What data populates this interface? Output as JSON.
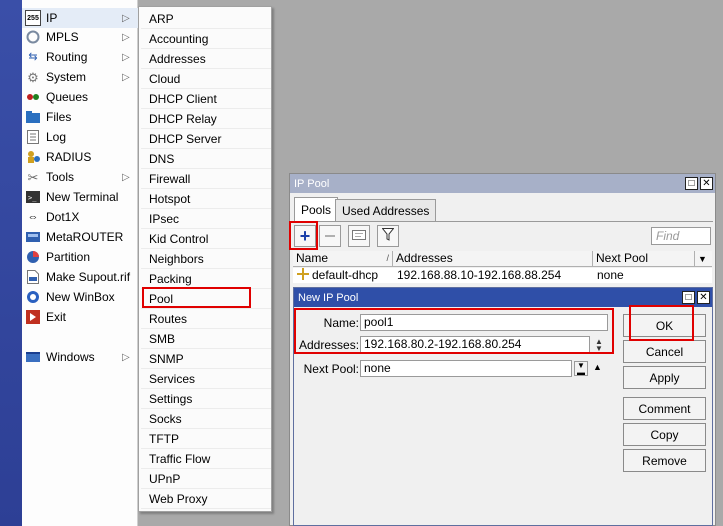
{
  "main_menu": {
    "items": [
      {
        "label": "IP",
        "icon": "ip-icon",
        "has_submenu": true
      },
      {
        "label": "MPLS",
        "icon": "mpls-icon",
        "has_submenu": true
      },
      {
        "label": "Routing",
        "icon": "routing-icon",
        "has_submenu": true
      },
      {
        "label": "System",
        "icon": "gear-icon",
        "has_submenu": true
      },
      {
        "label": "Queues",
        "icon": "queues-icon",
        "has_submenu": false
      },
      {
        "label": "Files",
        "icon": "folder-icon",
        "has_submenu": false
      },
      {
        "label": "Log",
        "icon": "log-icon",
        "has_submenu": false
      },
      {
        "label": "RADIUS",
        "icon": "radius-icon",
        "has_submenu": false
      },
      {
        "label": "Tools",
        "icon": "tools-icon",
        "has_submenu": true
      },
      {
        "label": "New Terminal",
        "icon": "terminal-icon",
        "has_submenu": false
      },
      {
        "label": "Dot1X",
        "icon": "dot1x-icon",
        "has_submenu": false
      },
      {
        "label": "MetaROUTER",
        "icon": "metarouter-icon",
        "has_submenu": false
      },
      {
        "label": "Partition",
        "icon": "partition-icon",
        "has_submenu": false
      },
      {
        "label": "Make Supout.rif",
        "icon": "supout-icon",
        "has_submenu": false
      },
      {
        "label": "New WinBox",
        "icon": "winbox-icon",
        "has_submenu": false
      },
      {
        "label": "Exit",
        "icon": "exit-icon",
        "has_submenu": false
      },
      {
        "label": "Windows",
        "icon": "windows-icon",
        "has_submenu": true
      }
    ]
  },
  "ip_submenu": {
    "items": [
      "ARP",
      "Accounting",
      "Addresses",
      "Cloud",
      "DHCP Client",
      "DHCP Relay",
      "DHCP Server",
      "DNS",
      "Firewall",
      "Hotspot",
      "IPsec",
      "Kid Control",
      "Neighbors",
      "Packing",
      "Pool",
      "Routes",
      "SMB",
      "SNMP",
      "Services",
      "Settings",
      "Socks",
      "TFTP",
      "Traffic Flow",
      "UPnP",
      "Web Proxy"
    ]
  },
  "ip_pool_window": {
    "title": "IP Pool",
    "tabs": [
      "Pools",
      "Used Addresses"
    ],
    "find_placeholder": "Find",
    "columns": [
      "Name",
      "Addresses",
      "Next Pool"
    ],
    "rows": [
      {
        "name": "default-dhcp",
        "addresses": "192.168.88.10-192.168.88.254",
        "next_pool": "none"
      }
    ]
  },
  "new_pool_dialog": {
    "title": "New IP Pool",
    "name_label": "Name:",
    "name_value": "pool1",
    "addresses_label": "Addresses:",
    "addresses_value": "192.168.80.2-192.168.80.254",
    "next_pool_label": "Next Pool:",
    "next_pool_value": "none",
    "buttons": {
      "ok": "OK",
      "cancel": "Cancel",
      "apply": "Apply",
      "comment": "Comment",
      "copy": "Copy",
      "remove": "Remove"
    }
  },
  "colors": {
    "window_title": "#a7b0c8",
    "dialog_title": "#2f4fa8",
    "highlight_box": "#e00000",
    "left_bar": "#3a4fa8"
  }
}
